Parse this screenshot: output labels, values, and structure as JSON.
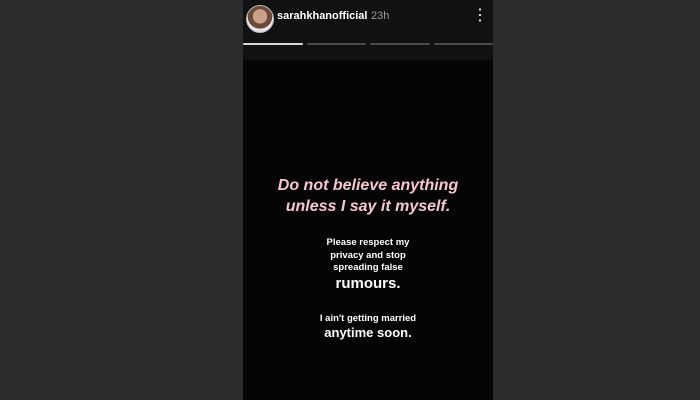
{
  "story": {
    "username": "sarahkhanofficial",
    "time": "23h",
    "more_icon": "⋮",
    "segments": 4,
    "active_segment": 1
  },
  "message": {
    "headline_line1": "Do not believe anything",
    "headline_line2": "unless I say it myself.",
    "p1_line1": "Please respect my",
    "p1_line2": "privacy and stop",
    "p1_line3": "spreading false",
    "p1_big": "rumours.",
    "p2_line1": "I ain't getting married",
    "p2_big": "anytime soon."
  },
  "colors": {
    "background": "#050505",
    "headline": "#f7c6cf",
    "text": "#ffffff"
  }
}
